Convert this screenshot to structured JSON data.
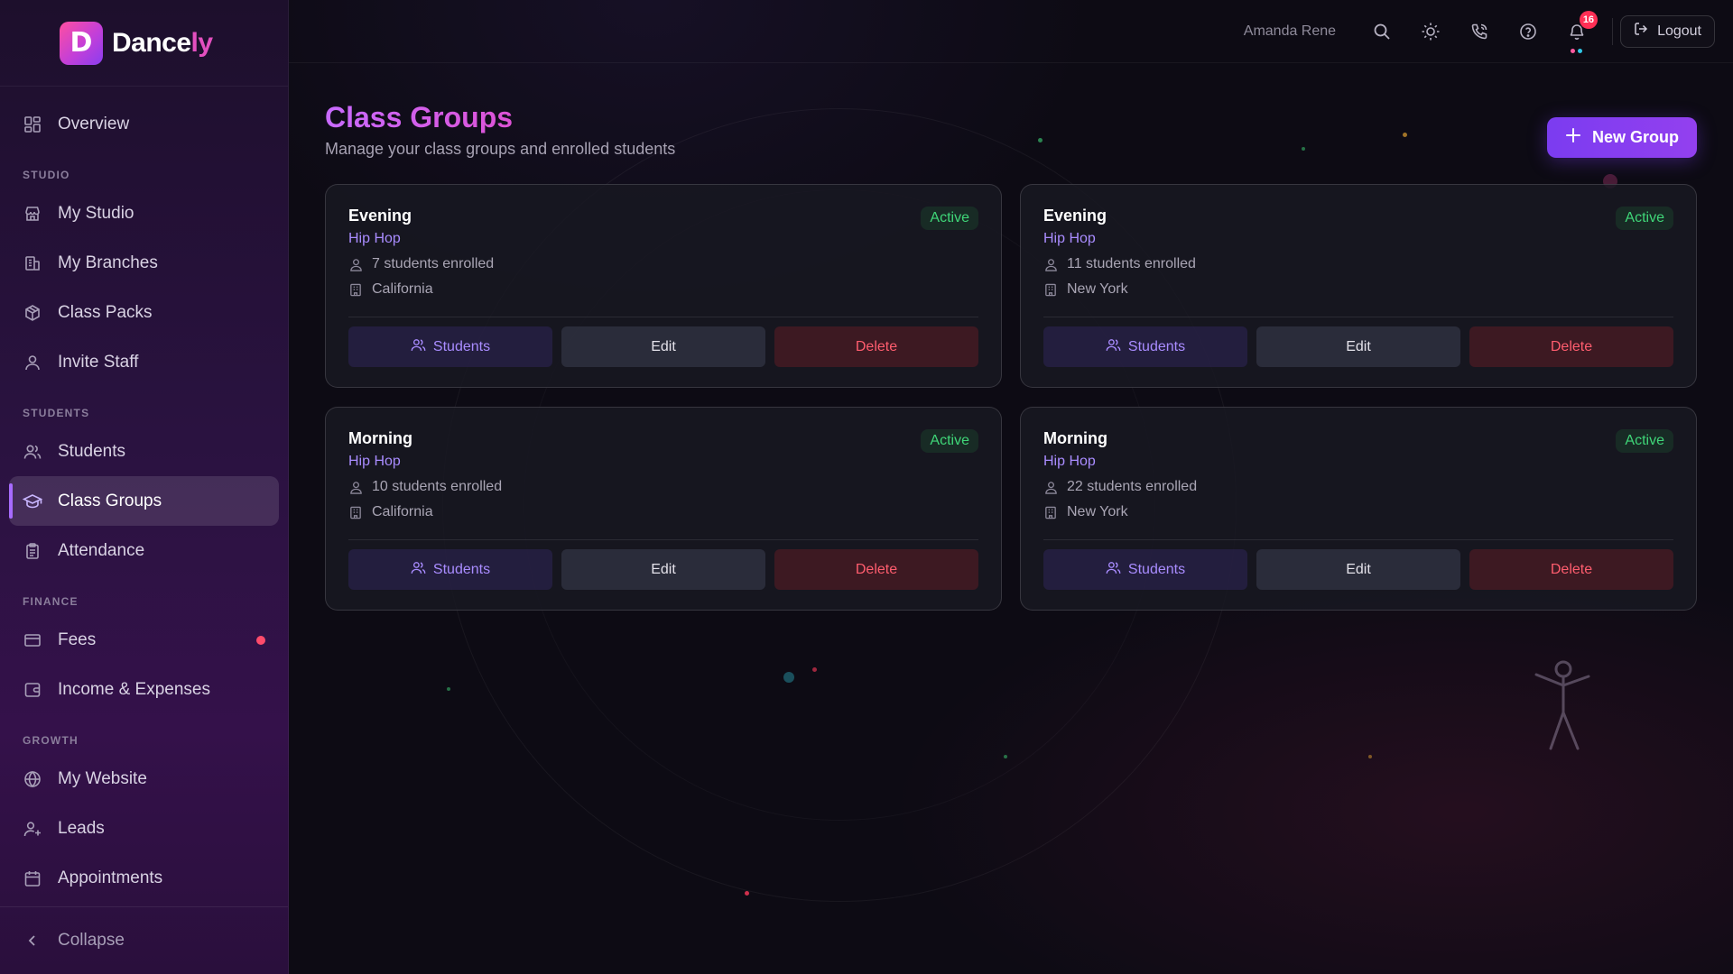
{
  "app": {
    "logo_letter": "D",
    "logo_main": "Dance",
    "logo_highlight": "ly"
  },
  "sidebar": {
    "overview": "Overview",
    "sections": {
      "studio": "STUDIO",
      "students": "STUDENTS",
      "finance": "FINANCE",
      "growth": "GROWTH"
    },
    "items": {
      "my_studio": "My Studio",
      "my_branches": "My Branches",
      "class_packs": "Class Packs",
      "invite_staff": "Invite Staff",
      "students": "Students",
      "class_groups": "Class Groups",
      "attendance": "Attendance",
      "fees": "Fees",
      "income_expenses": "Income & Expenses",
      "my_website": "My Website",
      "leads": "Leads",
      "appointments": "Appointments"
    },
    "active": "class_groups",
    "collapse_label": "Collapse"
  },
  "topbar": {
    "user_name": "Amanda Rene",
    "notification_count": "16",
    "logout_label": "Logout"
  },
  "page": {
    "title": "Class Groups",
    "subtitle": "Manage your class groups and enrolled students",
    "new_button": "New Group"
  },
  "groups": [
    {
      "name": "Evening",
      "style": "Hip Hop",
      "status": "Active",
      "enrolled": "7 students enrolled",
      "location": "California"
    },
    {
      "name": "Evening",
      "style": "Hip Hop",
      "status": "Active",
      "enrolled": "11 students enrolled",
      "location": "New York"
    },
    {
      "name": "Morning",
      "style": "Hip Hop",
      "status": "Active",
      "enrolled": "10 students enrolled",
      "location": "California"
    },
    {
      "name": "Morning",
      "style": "Hip Hop",
      "status": "Active",
      "enrolled": "22 students enrolled",
      "location": "New York"
    }
  ],
  "card_actions": {
    "students": "Students",
    "edit": "Edit",
    "delete": "Delete"
  },
  "colors": {
    "accent": "#7b3cf0",
    "active_status": "#3fd678",
    "delete": "#ff5d6e",
    "badge": "#ff2f55"
  }
}
